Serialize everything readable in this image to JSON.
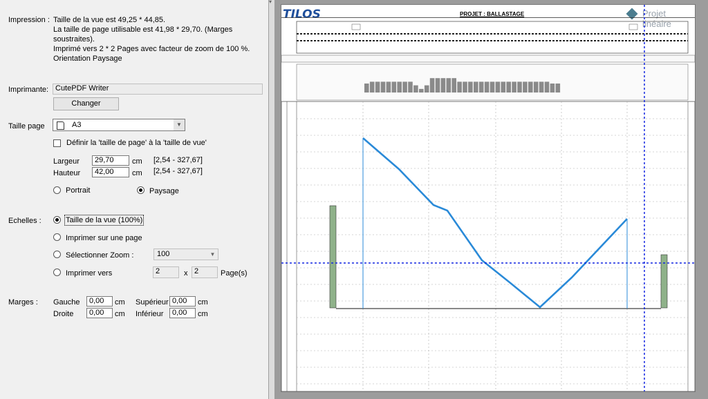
{
  "impression": {
    "label": "Impression :",
    "line1": "Taille de la vue est 49,25 * 44,85.",
    "line2": "La taille de page utilisable est 41,98 * 29,70. (Marges",
    "line3": "soustraites).",
    "line4": "Imprimé vers 2 * 2 Pages avec facteur de zoom  de 100 %.",
    "line5": "Orientation Paysage"
  },
  "imprimante": {
    "label": "Imprimante:",
    "value": "CutePDF Writer",
    "change_label": "Changer"
  },
  "taille_page": {
    "label": "Taille page",
    "value": "A3",
    "define_label": "Définir la 'taille de page' à la 'taille de vue'",
    "define_checked": false,
    "largeur_label": "Largeur",
    "largeur_value": "29,70",
    "largeur_unit": "cm",
    "largeur_range": "[2,54 - 327,67]",
    "hauteur_label": "Hauteur",
    "hauteur_value": "42,00",
    "hauteur_unit": "cm",
    "hauteur_range": "[2,54 - 327,67]",
    "portrait_label": "Portrait",
    "paysage_label": "Paysage",
    "orientation": "Paysage"
  },
  "echelles": {
    "label": "Echelles :",
    "option1": "Taille de la vue (100%)",
    "option2": "Imprimer sur une page",
    "option3": "Sélectionner Zoom :",
    "zoom_value": "100",
    "option4": "Imprimer vers",
    "pages_x": "2",
    "x_label": "x",
    "pages_y": "2",
    "pages_label": "Page(s)",
    "selected": "option1"
  },
  "marges": {
    "label": "Marges :",
    "gauche_label": "Gauche",
    "gauche_value": "0,00",
    "droite_label": "Droite",
    "droite_value": "0,00",
    "superieur_label": "Supérieur",
    "superieur_value": "0,00",
    "inferieur_label": "Inférieur",
    "inferieur_value": "0,00",
    "unit": "cm"
  },
  "preview": {
    "logo": "TILOS",
    "title": "PROJET : BALLASTAGE",
    "brand": "Projet linéaire",
    "accent_color": "#1f4f9c",
    "line_color": "#2a8ad8",
    "bar_color": "#8a8a8a",
    "histogram_values": [
      5,
      6,
      6,
      6,
      6,
      6,
      6,
      6,
      6,
      4,
      2,
      4,
      8,
      8,
      8,
      8,
      8,
      6,
      6,
      6,
      6,
      6,
      6,
      6,
      6,
      6,
      6,
      6,
      6,
      6,
      6,
      6,
      6,
      6,
      5,
      5
    ]
  }
}
